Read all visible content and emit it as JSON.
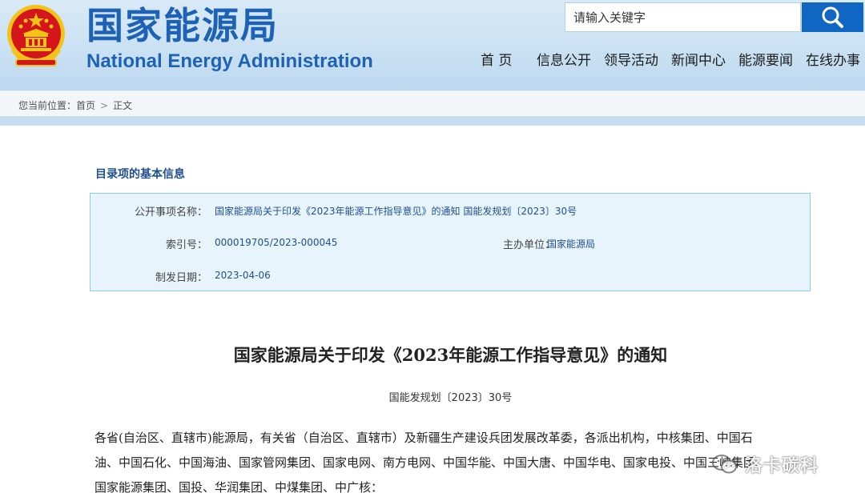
{
  "header": {
    "site_title_cn": "国家能源局",
    "site_title_en": "National Energy Administration",
    "search_placeholder": "请输入关键字",
    "nav": [
      "首 页",
      "信息公开",
      "领导活动",
      "新闻中心",
      "能源要闻",
      "在线办事"
    ]
  },
  "breadcrumb": {
    "prefix": "您当前位置：",
    "home": "首页",
    "separator": ">",
    "current": "正文"
  },
  "info": {
    "heading": "目录项的基本信息",
    "labels": {
      "name": "公开事项名称：",
      "index": "索引号：",
      "org": "主办单位：",
      "date": "制发日期："
    },
    "values": {
      "name": "国家能源局关于印发《2023年能源工作指导意见》的通知 国能发规划〔2023〕30号",
      "index": "000019705/2023-000045",
      "org": "国家能源局",
      "date": "2023-04-06"
    }
  },
  "document": {
    "title": "国家能源局关于印发《2023年能源工作指导意见》的通知",
    "number": "国能发规划〔2023〕30号",
    "body_lines": [
      "各省(自治区、直辖市)能源局，有关省（自治区、直辖市）及新疆生产建设兵团发展改革委，各派出机构，中核集团、中国石",
      "油、中国石化、中国海油、国家管网集团、国家电网、南方电网、中国华能、中国大唐、中国华电、国家电投、中国三峡集团、",
      "国家能源集团、国投、华润集团、中煤集团、中广核："
    ]
  },
  "watermark": {
    "text": "洛卡碳科",
    "icon": "wechat-icon"
  },
  "colors": {
    "brand_blue": "#1d62b5",
    "search_button": "#1166c3",
    "info_bg": "#e8f4fb",
    "info_border": "#8ccde8",
    "emblem_red": "#d4161c",
    "emblem_gold": "#f3c318"
  }
}
